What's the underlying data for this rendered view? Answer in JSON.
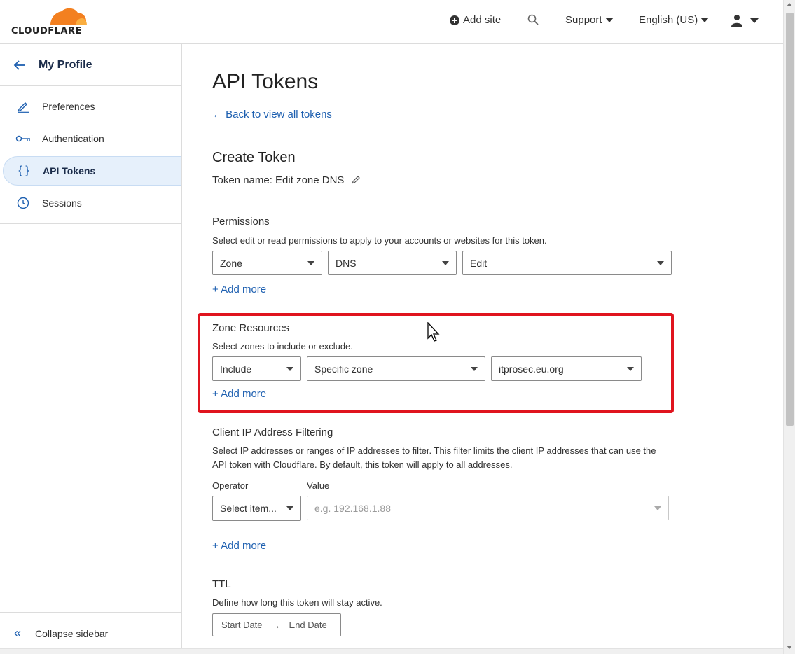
{
  "header": {
    "logo_text": "CLOUDFLARE",
    "add_site": "Add site",
    "support": "Support",
    "language": "English (US)",
    "brand_color": "#f38020"
  },
  "sidebar": {
    "title": "My Profile",
    "items": [
      {
        "label": "Preferences",
        "icon": "pencil-icon"
      },
      {
        "label": "Authentication",
        "icon": "key-icon"
      },
      {
        "label": "API Tokens",
        "icon": "braces-icon",
        "active": true
      },
      {
        "label": "Sessions",
        "icon": "clock-icon"
      }
    ],
    "collapse": "Collapse sidebar"
  },
  "main": {
    "title": "API Tokens",
    "back_link": "Back to view all tokens",
    "create_title": "Create Token",
    "token_name": "Token name: Edit zone DNS",
    "permissions": {
      "title": "Permissions",
      "desc": "Select edit or read permissions to apply to your accounts or websites for this token.",
      "selects": [
        "Zone",
        "DNS",
        "Edit"
      ],
      "add_more": "+ Add more"
    },
    "zone_resources": {
      "title": "Zone Resources",
      "desc": "Select zones to include or exclude.",
      "selects": [
        "Include",
        "Specific zone",
        "itprosec.eu.org"
      ],
      "add_more": "+ Add more"
    },
    "ip_filter": {
      "title": "Client IP Address Filtering",
      "desc": "Select IP addresses or ranges of IP addresses to filter. This filter limits the client IP addresses that can use the API token with Cloudflare. By default, this token will apply to all addresses.",
      "operator_label": "Operator",
      "operator_value": "Select item...",
      "value_label": "Value",
      "value_placeholder": "e.g. 192.168.1.88",
      "add_more": "+ Add more"
    },
    "ttl": {
      "title": "TTL",
      "desc": "Define how long this token will stay active.",
      "start": "Start Date",
      "end": "End Date"
    }
  },
  "highlight_color": "#e0141e"
}
